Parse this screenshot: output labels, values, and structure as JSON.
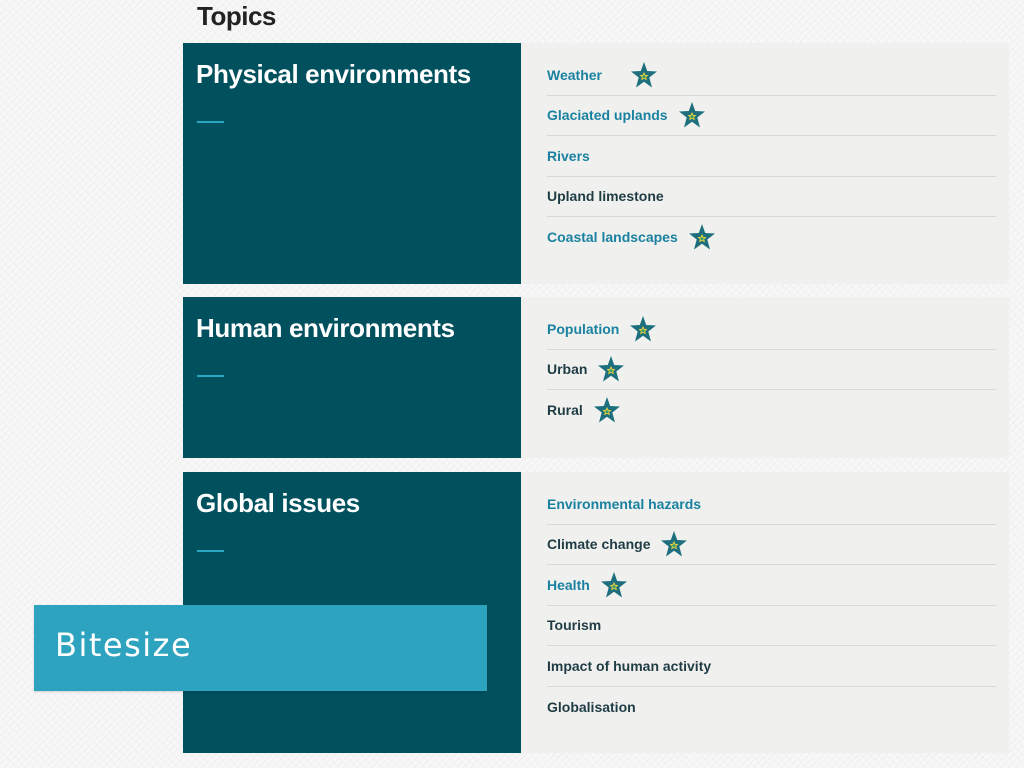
{
  "page": {
    "title": "Topics"
  },
  "sections": [
    {
      "title": "Physical environments",
      "topics": [
        {
          "label": "Weather",
          "starred": true
        },
        {
          "label": "Glaciated uplands",
          "starred": true
        },
        {
          "label": "Rivers",
          "starred": false
        },
        {
          "label": "Upland limestone",
          "starred": false
        },
        {
          "label": "Coastal landscapes",
          "starred": true
        }
      ]
    },
    {
      "title": "Human environments",
      "topics": [
        {
          "label": "Population",
          "starred": true
        },
        {
          "label": "Urban",
          "starred": true
        },
        {
          "label": "Rural",
          "starred": true
        }
      ]
    },
    {
      "title": "Global issues",
      "topics": [
        {
          "label": "Environmental hazards",
          "starred": false
        },
        {
          "label": "Climate change",
          "starred": true
        },
        {
          "label": "Health",
          "starred": true
        },
        {
          "label": "Tourism",
          "starred": false
        },
        {
          "label": "Impact of human activity",
          "starred": false
        },
        {
          "label": "Globalisation",
          "starred": false
        }
      ]
    }
  ],
  "banner": {
    "text": "Bitesize"
  },
  "colors": {
    "section_header_bg": "#00505e",
    "link_text": "#1a82a0",
    "plain_text": "#1f3c44",
    "accent_rule": "#2aa7c0",
    "banner_bg": "#2ea3bf",
    "star_fill": "#1d6f7d",
    "star_center": "#f0d23c"
  },
  "icons": {
    "star": "star-icon"
  }
}
